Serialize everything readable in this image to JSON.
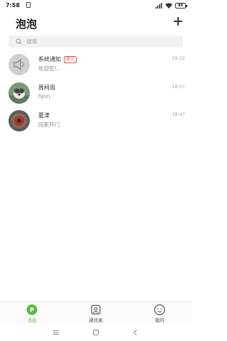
{
  "status_bar": {
    "time": "7:58",
    "battery": "84"
  },
  "header": {
    "title": "泡泡",
    "add_icon": "plus-icon"
  },
  "search": {
    "placeholder": "搜索",
    "icon": "search-icon"
  },
  "conversations": [
    {
      "name": "系统通知",
      "badge": "官方",
      "preview": "欢迎您!...",
      "time": "19:22",
      "avatar": "speaker-avatar"
    },
    {
      "name": "周柯雨",
      "preview": "hjnn",
      "time": "18:57",
      "avatar": "dog-photo-avatar"
    },
    {
      "name": "夏津",
      "preview": "回家开门",
      "time": "18:47",
      "avatar": "round-photo-avatar"
    }
  ],
  "bottom_nav": {
    "items": [
      {
        "label": "消息",
        "icon": "chat-bubble-icon",
        "active": true
      },
      {
        "label": "通讯录",
        "icon": "contacts-icon",
        "active": false
      },
      {
        "label": "我的",
        "icon": "profile-icon",
        "active": false
      }
    ]
  },
  "colors": {
    "accent": "#5fb84a",
    "badge": "#d9534f"
  }
}
